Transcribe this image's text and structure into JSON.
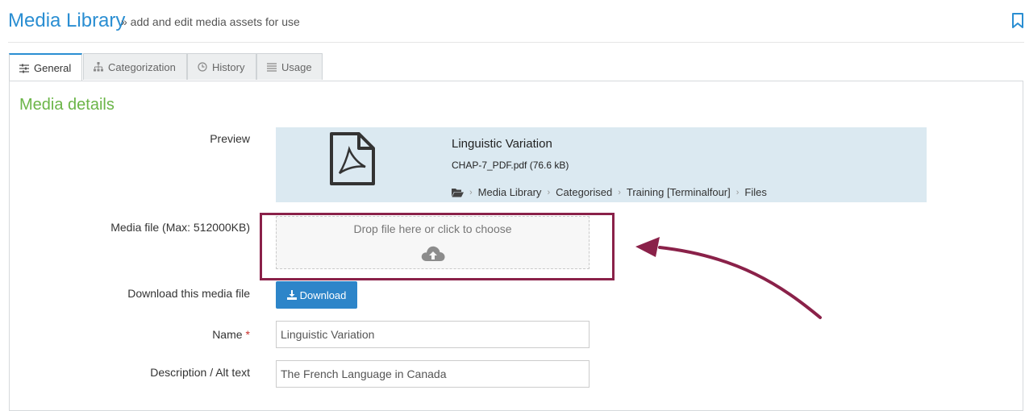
{
  "header": {
    "title": "Media Library",
    "subtitle": "» add and edit media assets for use",
    "bookmark_icon": "bookmark-icon"
  },
  "tabs": [
    {
      "label": "General",
      "icon": "sliders-icon",
      "active": true
    },
    {
      "label": "Categorization",
      "icon": "sitemap-icon",
      "active": false
    },
    {
      "label": "History",
      "icon": "clock-icon",
      "active": false
    },
    {
      "label": "Usage",
      "icon": "list-icon",
      "active": false
    }
  ],
  "section": {
    "title": "Media details"
  },
  "preview": {
    "label": "Preview",
    "icon": "pdf-file-icon",
    "name": "Linguistic Variation",
    "file": "CHAP-7_PDF.pdf (76.6 kB)",
    "breadcrumb": [
      "Media Library",
      "Categorised",
      "Training [Terminalfour]",
      "Files"
    ]
  },
  "media_file": {
    "label": "Media file (Max: 512000KB)",
    "drop_text": "Drop file here or click to choose",
    "icon": "cloud-upload-icon"
  },
  "download": {
    "label": "Download this media file",
    "button_label": "Download",
    "icon": "download-icon"
  },
  "name_field": {
    "label": "Name",
    "required_mark": "*",
    "value": "Linguistic Variation"
  },
  "description_field": {
    "label": "Description / Alt text",
    "value": "The French Language in Canada"
  },
  "colors": {
    "accent": "#2a8ed2",
    "section": "#6bb548",
    "highlight": "#8a2149",
    "button": "#2d85c9"
  }
}
